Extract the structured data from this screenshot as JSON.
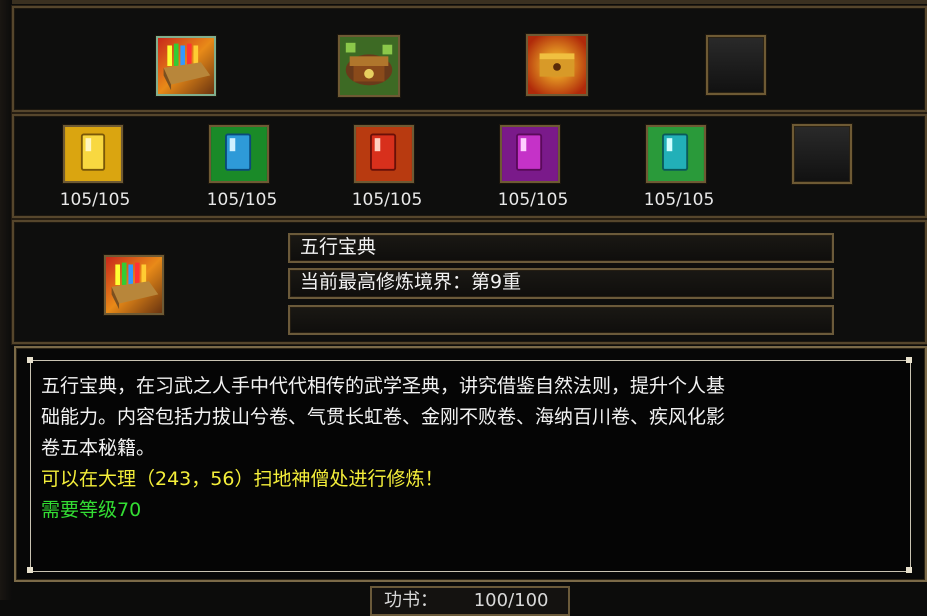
{
  "top_slots": [
    {
      "name": "wuxing-baodian-book",
      "selected": true
    },
    {
      "name": "green-treasure-chest",
      "selected": false
    },
    {
      "name": "gold-treasure-chest",
      "selected": false
    },
    {
      "name": "empty",
      "selected": false
    }
  ],
  "volumes": [
    {
      "color": "#e8b312",
      "count": "105/105"
    },
    {
      "color": "#2e9ad8",
      "count": "105/105"
    },
    {
      "color": "#d8301c",
      "count": "105/105"
    },
    {
      "color": "#c532c8",
      "count": "105/105"
    },
    {
      "color": "#22b0b8",
      "count": "105/105"
    },
    {
      "color": "",
      "count": ""
    }
  ],
  "skill": {
    "name": "五行宝典",
    "realm": "当前最高修炼境界：第9重",
    "extra": ""
  },
  "description": {
    "line1": "五行宝典，在习武之人手中代代相传的武学圣典，讲究借鉴自然法则，提升个人基",
    "line2": "础能力。内容包括力拔山兮卷、气贯长虹卷、金刚不败卷、海纳百川卷、疾风化影",
    "line3": "卷五本秘籍。",
    "location": "可以在大理（243，56）扫地神僧处进行修炼！",
    "requirement": "需要等级70"
  },
  "footer": {
    "label": "功书：",
    "value": "100/100"
  }
}
